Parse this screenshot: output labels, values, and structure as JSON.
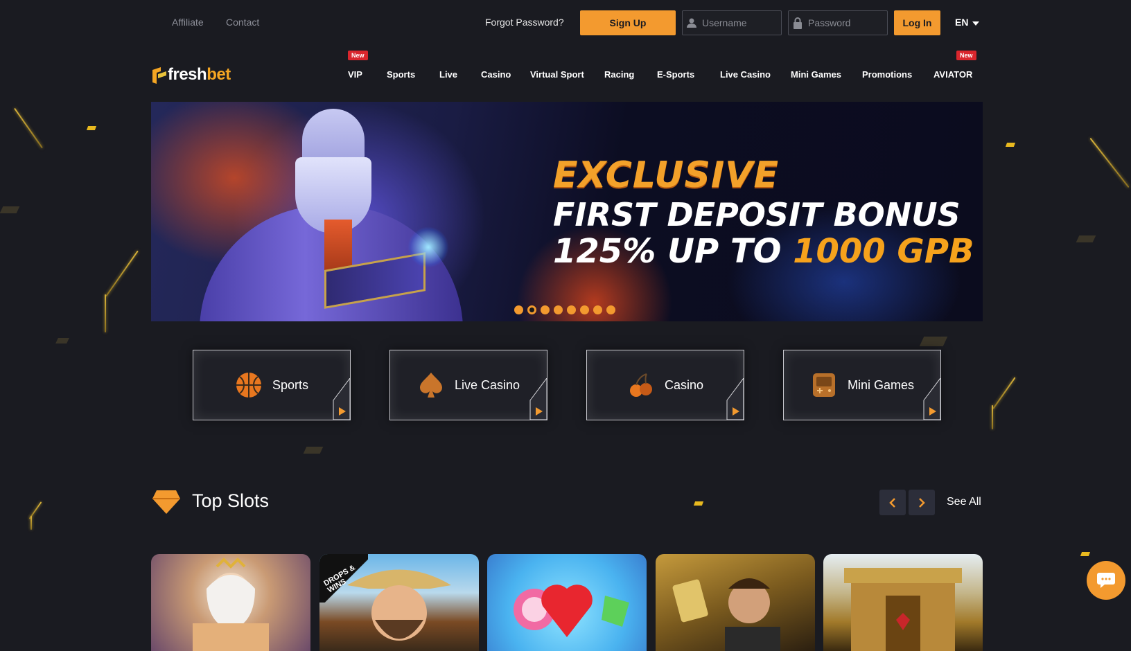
{
  "top_links": {
    "affiliate": "Affiliate",
    "contact": "Contact"
  },
  "auth": {
    "forgot": "Forgot Password?",
    "signup": "Sign Up",
    "username_placeholder": "Username",
    "password_placeholder": "Password",
    "login": "Log In",
    "language": "EN"
  },
  "logo": {
    "part1": "fresh",
    "part2": "bet"
  },
  "nav": {
    "items": [
      "VIP",
      "Sports",
      "Live",
      "Casino",
      "Virtual Sport",
      "Racing",
      "E-Sports",
      "Live Casino",
      "Mini Games",
      "Promotions",
      "AVIATOR"
    ],
    "badge_new": "New"
  },
  "banner": {
    "line1": "EXCLUSIVE",
    "line2": "FIRST DEPOSIT BONUS",
    "line3a": "125% UP TO ",
    "line3b": "1000 GPB",
    "slide_count": 8,
    "active_slide": 2
  },
  "categories": [
    "Sports",
    "Live Casino",
    "Casino",
    "Mini Games"
  ],
  "top_slots": {
    "title": "Top Slots",
    "see_all": "See All",
    "badge": "DROPS & WINS"
  },
  "colors": {
    "accent": "#f39a2f",
    "background": "#1a1b21",
    "badge_red": "#d9262d"
  }
}
